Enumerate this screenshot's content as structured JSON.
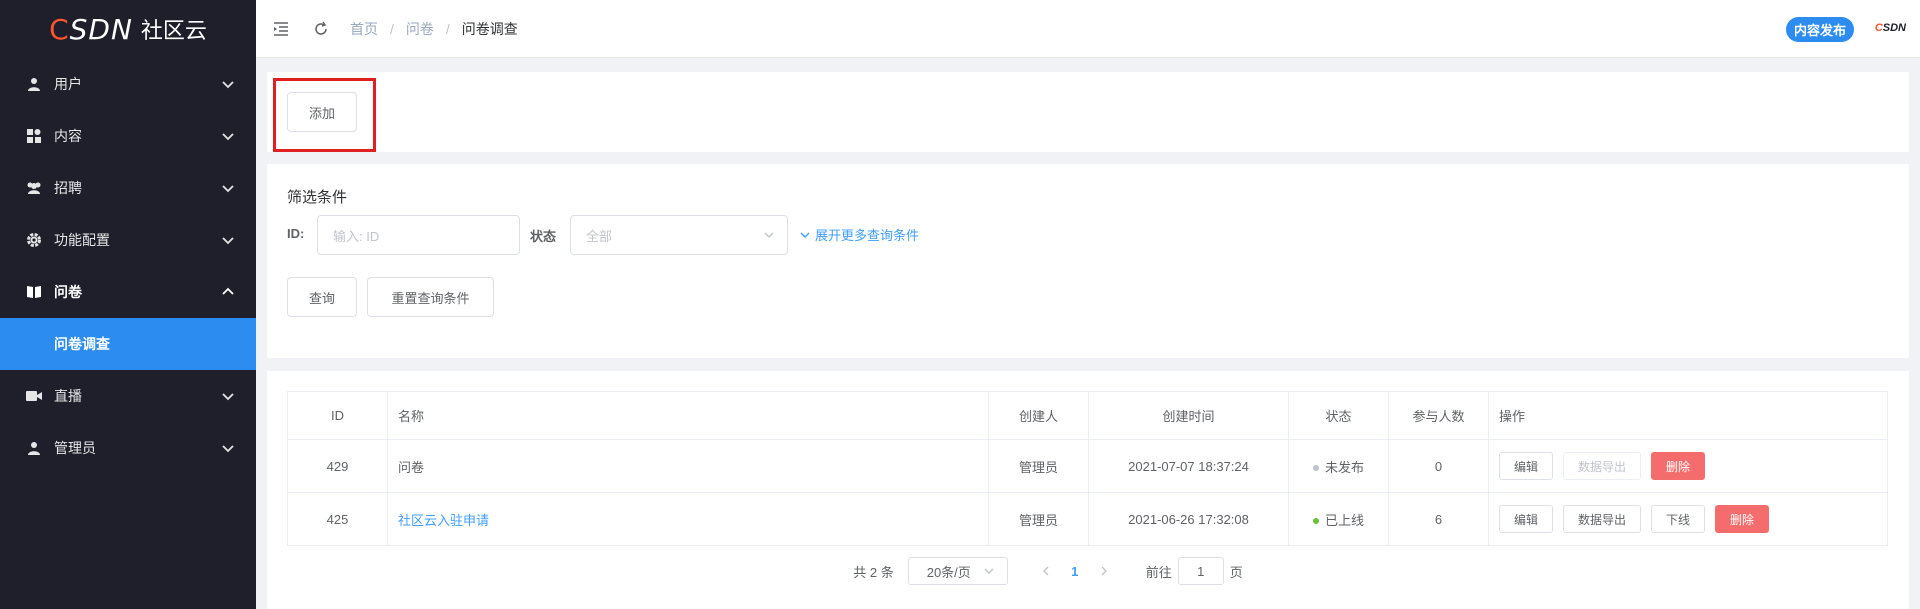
{
  "sidebar": {
    "logo": {
      "csdn": "CSDN",
      "c_letter": "C",
      "rest": "SDN",
      "text": "社区云"
    },
    "items": [
      {
        "label": "用户",
        "icon": "user-icon"
      },
      {
        "label": "内容",
        "icon": "content-icon"
      },
      {
        "label": "招聘",
        "icon": "recruit-icon"
      },
      {
        "label": "功能配置",
        "icon": "gear-icon"
      },
      {
        "label": "问卷",
        "icon": "book-icon",
        "open": true
      },
      {
        "label": "直播",
        "icon": "video-icon"
      },
      {
        "label": "管理员",
        "icon": "admin-icon"
      }
    ],
    "sub_item": "问卷调查"
  },
  "header": {
    "breadcrumb": [
      "首页",
      "问卷",
      "问卷调查"
    ],
    "publish_label": "内容发布",
    "brand_c": "C",
    "brand_rest": "SDN"
  },
  "toolbar": {
    "add_label": "添加"
  },
  "filter": {
    "title": "筛选条件",
    "id_label": "ID:",
    "id_placeholder": "输入: ID",
    "status_label": "状态",
    "status_value": "全部",
    "more_label": "展开更多查询条件",
    "query_label": "查询",
    "reset_label": "重置查询条件"
  },
  "table": {
    "columns": [
      "ID",
      "名称",
      "创建人",
      "创建时间",
      "状态",
      "参与人数",
      "操作"
    ],
    "rows": [
      {
        "id": "429",
        "name": "问卷",
        "creator": "管理员",
        "created": "2021-07-07 18:37:24",
        "status": "未发布",
        "status_color": "#c0c4cc",
        "count": "0",
        "ops": [
          "编辑",
          "数据导出",
          "删除"
        ]
      },
      {
        "id": "425",
        "name": "社区云入驻申请",
        "creator": "管理员",
        "created": "2021-06-26 17:32:08",
        "status": "已上线",
        "status_color": "#67c23a",
        "count": "6",
        "ops": [
          "编辑",
          "数据导出",
          "下线",
          "删除"
        ]
      }
    ]
  },
  "pagination": {
    "total": "共 2 条",
    "size": "20条/页",
    "current": "1",
    "goto_prefix": "前往",
    "goto_value": "1",
    "goto_suffix": "页"
  },
  "colors": {
    "accent": "#2d8cf0",
    "danger": "#f56c6c",
    "sidebar_bg": "#1e1f2b",
    "highlight": "#e02020"
  }
}
